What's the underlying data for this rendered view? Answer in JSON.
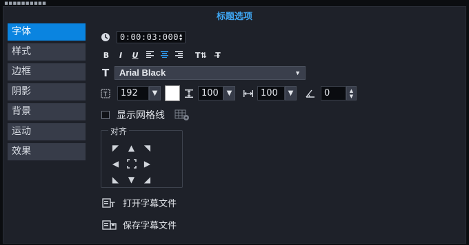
{
  "panel": {
    "title": "标题选项"
  },
  "tabs": [
    {
      "label": "字体",
      "active": true
    },
    {
      "label": "样式"
    },
    {
      "label": "边框"
    },
    {
      "label": "阴影"
    },
    {
      "label": "背景"
    },
    {
      "label": "运动"
    },
    {
      "label": "效果"
    }
  ],
  "duration": {
    "value": "0:00:03:000"
  },
  "format_buttons": [
    {
      "label": "B",
      "name": "bold-button"
    },
    {
      "label": "I",
      "name": "italic-button"
    },
    {
      "label": "U",
      "name": "underline-button"
    },
    {
      "label": "≡",
      "name": "align-left-button"
    },
    {
      "label": "≡",
      "name": "align-center-button"
    },
    {
      "label": "≡",
      "name": "align-right-button"
    },
    {
      "label": "T⇅",
      "name": "text-direction-button"
    },
    {
      "label": "T̶",
      "name": "text-flip-button"
    }
  ],
  "font": {
    "family": "Arial Black"
  },
  "size": {
    "value": "192"
  },
  "line_spacing": {
    "value": "100"
  },
  "char_spacing": {
    "value": "100"
  },
  "rotation": {
    "value": "0"
  },
  "colors": {
    "accent": "#0a84e0",
    "title": "#3fa6f2",
    "text_color_swatch": "#ffffff"
  },
  "grid": {
    "label": "显示网格线",
    "checked": false
  },
  "alignment": {
    "label": "对齐"
  },
  "actions": {
    "open_subtitle": "打开字幕文件",
    "save_subtitle": "保存字幕文件"
  }
}
